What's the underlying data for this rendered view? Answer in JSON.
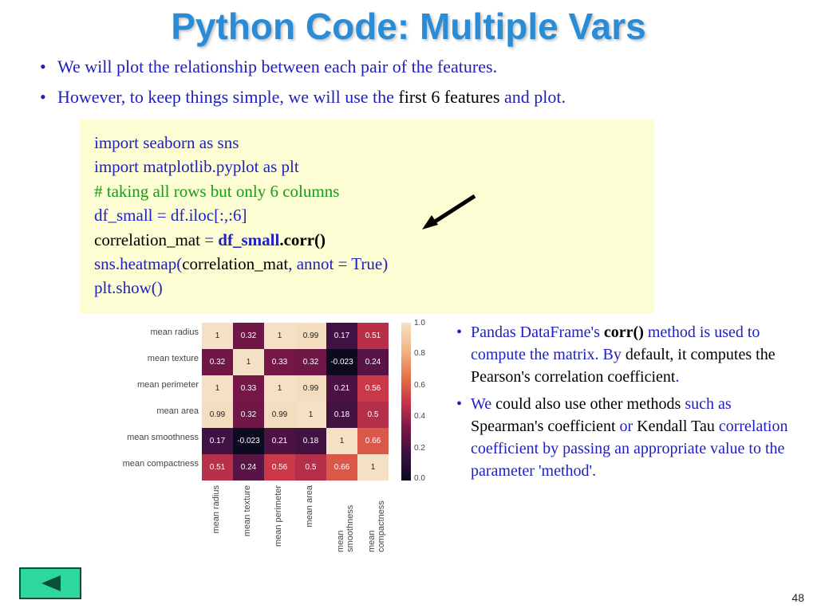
{
  "title": "Python Code: Multiple Vars",
  "bullets": {
    "b1": "We will plot the relationship between each pair of the features.",
    "b2a": "However, to keep things simple, we will use the ",
    "b2b": "first 6 features",
    "b2c": " and plot."
  },
  "code": {
    "l1": "import seaborn as sns",
    "l2": "import matplotlib.pyplot as plt",
    "l3": "# taking all rows but only 6 columns",
    "l4": "df_small = df.iloc[:,:6]",
    "l5a": "correlation_mat ",
    "l5b": "= ",
    "l5c": "df_small",
    "l5d": ".corr()",
    "l6a": "sns.heatmap(",
    "l6b": "correlation_mat",
    "l6c": ", annot = True)",
    "l7": "plt.show()"
  },
  "chart_data": {
    "type": "heatmap",
    "title": "",
    "xlabel": "",
    "ylabel": "",
    "categories": [
      "mean radius",
      "mean texture",
      "mean perimeter",
      "mean area",
      "mean smoothness",
      "mean compactness"
    ],
    "matrix": [
      [
        1,
        0.32,
        1,
        0.99,
        0.17,
        0.51
      ],
      [
        0.32,
        1,
        0.33,
        0.32,
        -0.023,
        0.24
      ],
      [
        1,
        0.33,
        1,
        0.99,
        0.21,
        0.56
      ],
      [
        0.99,
        0.32,
        0.99,
        1,
        0.18,
        0.5
      ],
      [
        0.17,
        -0.023,
        0.21,
        0.18,
        1,
        0.66
      ],
      [
        0.51,
        0.24,
        0.56,
        0.5,
        0.66,
        1
      ]
    ],
    "colorbar_ticks": [
      "0.0",
      "0.2",
      "0.4",
      "0.6",
      "0.8",
      "1.0"
    ],
    "colorbar_range": [
      0.0,
      1.0
    ]
  },
  "right": {
    "r1a": "Pandas DataFrame's ",
    "r1b": "corr()",
    "r1c": " method is used to compute the matrix. By ",
    "r1d": "default, it computes the Pearson's correlation coefficient",
    "r1e": ".",
    "r2a": "We ",
    "r2b": "could also use other methods",
    "r2c": " such as ",
    "r2d": "Spearman's coefficient ",
    "r2e": "or ",
    "r2f": "Kendall Tau ",
    "r2g": "correlation coefficient by passing an appropriate value to the parameter 'method'."
  },
  "page_number": "48"
}
